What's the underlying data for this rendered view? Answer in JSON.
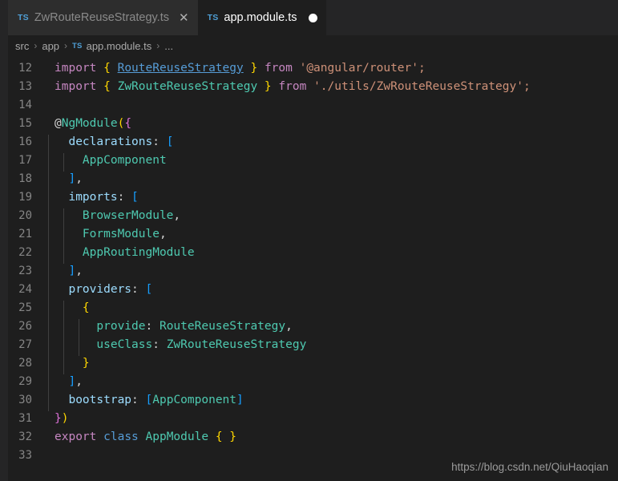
{
  "window": {
    "background": "#1e1e1e",
    "tabbar_background": "#252526"
  },
  "tabbar": {
    "tabs": [
      {
        "label": "ZwRouteReuseStrategy.ts",
        "icon": "typescript-file-icon",
        "icon_label": "TS",
        "active": false,
        "dirty": false,
        "close_glyph": "✕"
      },
      {
        "label": "app.module.ts",
        "icon": "typescript-file-icon",
        "icon_label": "TS",
        "active": true,
        "dirty": true,
        "close_glyph": ""
      }
    ]
  },
  "breadcrumb": {
    "separator": "›",
    "ts_badge": "TS",
    "items": [
      "src",
      "app",
      "app.module.ts",
      "..."
    ]
  },
  "editor": {
    "language": "typescript",
    "first_line_number": 12,
    "last_line_number": 33,
    "line_numbers": [
      12,
      13,
      14,
      15,
      16,
      17,
      18,
      19,
      20,
      21,
      22,
      23,
      24,
      25,
      26,
      27,
      28,
      29,
      30,
      31,
      32,
      33
    ],
    "lines": [
      {
        "n": 12,
        "text": "import { RouteReuseStrategy } from '@angular/router';"
      },
      {
        "n": 13,
        "text": "import { ZwRouteReuseStrategy } from './utils/ZwRouteReuseStrategy';"
      },
      {
        "n": 14,
        "text": ""
      },
      {
        "n": 15,
        "text": "@NgModule({"
      },
      {
        "n": 16,
        "text": "  declarations: ["
      },
      {
        "n": 17,
        "text": "    AppComponent"
      },
      {
        "n": 18,
        "text": "  ],"
      },
      {
        "n": 19,
        "text": "  imports: ["
      },
      {
        "n": 20,
        "text": "    BrowserModule,"
      },
      {
        "n": 21,
        "text": "    FormsModule,"
      },
      {
        "n": 22,
        "text": "    AppRoutingModule"
      },
      {
        "n": 23,
        "text": "  ],"
      },
      {
        "n": 24,
        "text": "  providers: ["
      },
      {
        "n": 25,
        "text": "    {"
      },
      {
        "n": 26,
        "text": "      provide: RouteReuseStrategy,"
      },
      {
        "n": 27,
        "text": "      useClass: ZwRouteReuseStrategy"
      },
      {
        "n": 28,
        "text": "    }"
      },
      {
        "n": 29,
        "text": "  ],"
      },
      {
        "n": 30,
        "text": "  bootstrap: [AppComponent]"
      },
      {
        "n": 31,
        "text": "})"
      },
      {
        "n": 32,
        "text": "export class AppModule { }"
      },
      {
        "n": 33,
        "text": ""
      }
    ],
    "tokens": {
      "kw_import": "import",
      "kw_from": "from",
      "kw_export": "export",
      "kw_class": "class",
      "str_angular_router": "'@angular/router';",
      "str_utils_path": "'./utils/ZwRouteReuseStrategy';",
      "type_RouteReuseStrategy": "RouteReuseStrategy",
      "type_ZwRouteReuseStrategy": "ZwRouteReuseStrategy",
      "deco_NgModule": "NgModule",
      "prop_declarations": "declarations",
      "prop_imports": "imports",
      "prop_providers": "providers",
      "prop_bootstrap": "bootstrap",
      "prop_provide": "provide",
      "prop_useClass": "useClass",
      "id_AppComponent": "AppComponent",
      "id_BrowserModule": "BrowserModule",
      "id_FormsModule": "FormsModule",
      "id_AppRoutingModule": "AppRoutingModule",
      "id_AppModule": "AppModule"
    },
    "colors": {
      "keyword": "#c586c0",
      "keyword_blue": "#569cd6",
      "string": "#ce9178",
      "type": "#4ec9b0",
      "property": "#9cdcfe",
      "linenumber": "#858585",
      "foreground": "#d4d4d4",
      "bracket_yellow": "#ffd700",
      "bracket_purple": "#da70d6",
      "bracket_blue": "#179fff",
      "indent_guide": "#404040"
    }
  },
  "watermark": {
    "text": "https://blog.csdn.net/QiuHaoqian"
  }
}
